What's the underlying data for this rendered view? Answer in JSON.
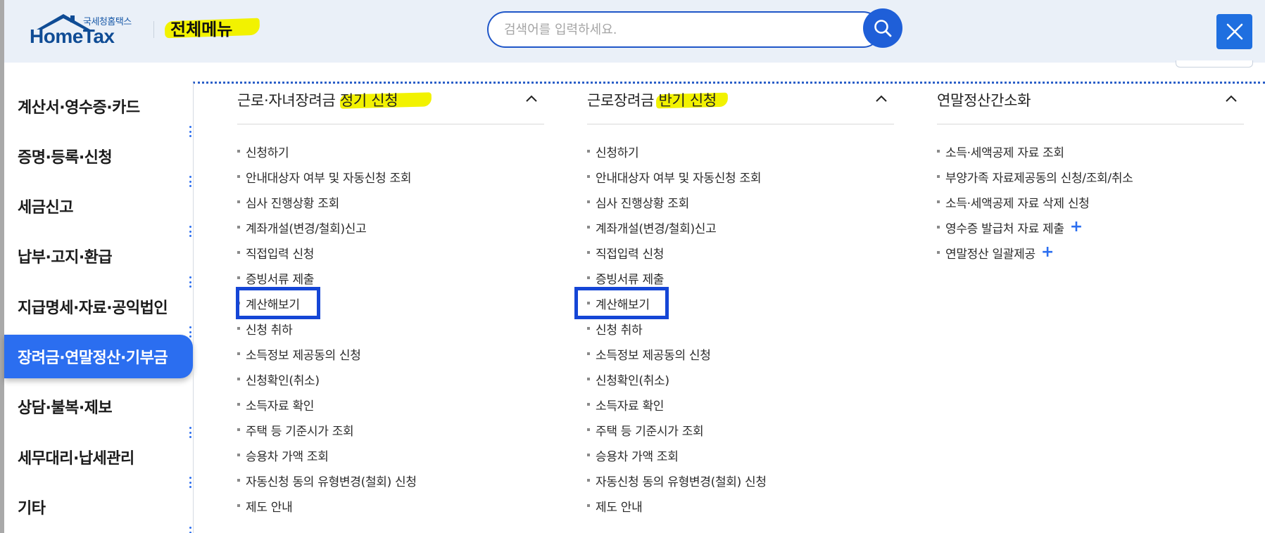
{
  "header": {
    "logo_sub": "국세청홈택스",
    "logo_main": "HomeTax",
    "menu_title": "전체메뉴",
    "search_placeholder": "검색어를 입력하세요."
  },
  "sidebar": {
    "items": [
      {
        "label": "계산서·영수증·카드"
      },
      {
        "label": "증명·등록·신청"
      },
      {
        "label": "세금신고"
      },
      {
        "label": "납부·고지·환급"
      },
      {
        "label": "지급명세·자료·공익법인"
      },
      {
        "label": "장려금·연말정산·기부금"
      },
      {
        "label": "상담·불복·제보"
      },
      {
        "label": "세무대리·납세관리"
      },
      {
        "label": "기타"
      }
    ],
    "active_index": 5
  },
  "columns": [
    {
      "title": "근로·자녀장려금 정기 신청",
      "items": [
        {
          "label": "신청하기"
        },
        {
          "label": "안내대상자 여부 및 자동신청 조회"
        },
        {
          "label": "심사 진행상황 조회"
        },
        {
          "label": "계좌개설(변경/철회)신고"
        },
        {
          "label": "직접입력 신청"
        },
        {
          "label": "증빙서류 제출"
        },
        {
          "label": "계산해보기"
        },
        {
          "label": "신청 취하"
        },
        {
          "label": "소득정보 제공동의 신청"
        },
        {
          "label": "신청확인(취소)"
        },
        {
          "label": "소득자료 확인"
        },
        {
          "label": "주택 등 기준시가 조회"
        },
        {
          "label": "승용차 가액 조회"
        },
        {
          "label": "자동신청 동의 유형변경(철회) 신청"
        },
        {
          "label": "제도 안내"
        }
      ]
    },
    {
      "title": "근로장려금 반기 신청",
      "items": [
        {
          "label": "신청하기"
        },
        {
          "label": "안내대상자 여부 및 자동신청 조회"
        },
        {
          "label": "심사 진행상황 조회"
        },
        {
          "label": "계좌개설(변경/철회)신고"
        },
        {
          "label": "직접입력 신청"
        },
        {
          "label": "증빙서류 제출"
        },
        {
          "label": "계산해보기"
        },
        {
          "label": "신청 취하"
        },
        {
          "label": "소득정보 제공동의 신청"
        },
        {
          "label": "신청확인(취소)"
        },
        {
          "label": "소득자료 확인"
        },
        {
          "label": "주택 등 기준시가 조회"
        },
        {
          "label": "승용차 가액 조회"
        },
        {
          "label": "자동신청 동의 유형변경(철회) 신청"
        },
        {
          "label": "제도 안내"
        }
      ]
    },
    {
      "title": "연말정산간소화",
      "items": [
        {
          "label": "소득·세액공제 자료 조회"
        },
        {
          "label": "부양가족 자료제공동의 신청/조회/취소"
        },
        {
          "label": "소득·세액공제 자료 삭제 신청"
        },
        {
          "label": "영수증 발급처 자료 제출",
          "plus": "+"
        },
        {
          "label": "연말정산 일괄제공",
          "plus": "+"
        }
      ]
    }
  ],
  "colors": {
    "accent": "#2b6ef0",
    "highlight": "#f2f200",
    "box": "#1546d6"
  }
}
